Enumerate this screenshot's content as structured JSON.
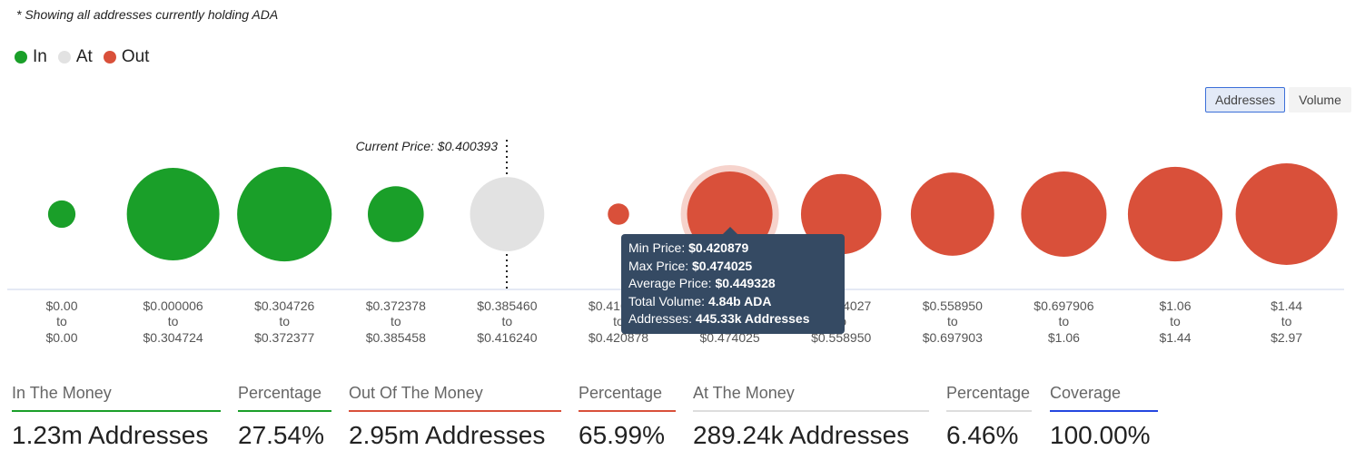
{
  "note": "* Showing all addresses currently holding ADA",
  "legend": [
    {
      "label": "In",
      "color": "#1a9f29"
    },
    {
      "label": "At",
      "color": "#e2e2e2"
    },
    {
      "label": "Out",
      "color": "#d9503a"
    }
  ],
  "toggle": {
    "options": [
      "Addresses",
      "Volume"
    ],
    "selected": "Addresses"
  },
  "chart_data": {
    "type": "bubble",
    "current_price_label": "Current Price: $0.400393",
    "current_price": 0.400393,
    "bins": [
      {
        "from": "$0.00",
        "to": "$0.00",
        "status": "in",
        "relative_size": 0.27
      },
      {
        "from": "$0.000006",
        "to": "$0.304724",
        "status": "in",
        "relative_size": 0.91
      },
      {
        "from": "$0.304726",
        "to": "$0.372377",
        "status": "in",
        "relative_size": 0.93
      },
      {
        "from": "$0.372378",
        "to": "$0.385458",
        "status": "in",
        "relative_size": 0.55
      },
      {
        "from": "$0.385460",
        "to": "$0.416240",
        "status": "at",
        "relative_size": 0.73
      },
      {
        "from": "$0.416241",
        "to": "$0.420878",
        "status": "out",
        "relative_size": 0.21
      },
      {
        "from": "$0.420879",
        "to": "$0.474025",
        "status": "out",
        "relative_size": 0.84,
        "hovered": true
      },
      {
        "from": "$0.474027",
        "to": "$0.558950",
        "status": "out",
        "relative_size": 0.79
      },
      {
        "from": "$0.558950",
        "to": "$0.697903",
        "status": "out",
        "relative_size": 0.82
      },
      {
        "from": "$0.697906",
        "to": "$1.06",
        "status": "out",
        "relative_size": 0.84
      },
      {
        "from": "$1.06",
        "to": "$1.44",
        "status": "out",
        "relative_size": 0.93
      },
      {
        "from": "$1.44",
        "to": "$2.97",
        "status": "out",
        "relative_size": 1.0
      }
    ],
    "tick_connector": "to",
    "tooltip": [
      {
        "label": "Min Price:",
        "value": "$0.420879"
      },
      {
        "label": "Max Price:",
        "value": "$0.474025"
      },
      {
        "label": "Average Price:",
        "value": "$0.449328"
      },
      {
        "label": "Total Volume:",
        "value": "4.84b ADA"
      },
      {
        "label": "Addresses:",
        "value": "445.33k Addresses"
      }
    ]
  },
  "stats": [
    {
      "label": "In The Money",
      "value": "1.23m Addresses",
      "color": "#1a9f29"
    },
    {
      "label": "Percentage",
      "value": "27.54%",
      "color": "#1a9f29"
    },
    {
      "label": "Out Of The Money",
      "value": "2.95m Addresses",
      "color": "#d9503a"
    },
    {
      "label": "Percentage",
      "value": "65.99%",
      "color": "#d9503a"
    },
    {
      "label": "At The Money",
      "value": "289.24k Addresses",
      "color": "#dddddd"
    },
    {
      "label": "Percentage",
      "value": "6.46%",
      "color": "#dddddd"
    },
    {
      "label": "Coverage",
      "value": "100.00%",
      "color": "#2446e0"
    }
  ]
}
